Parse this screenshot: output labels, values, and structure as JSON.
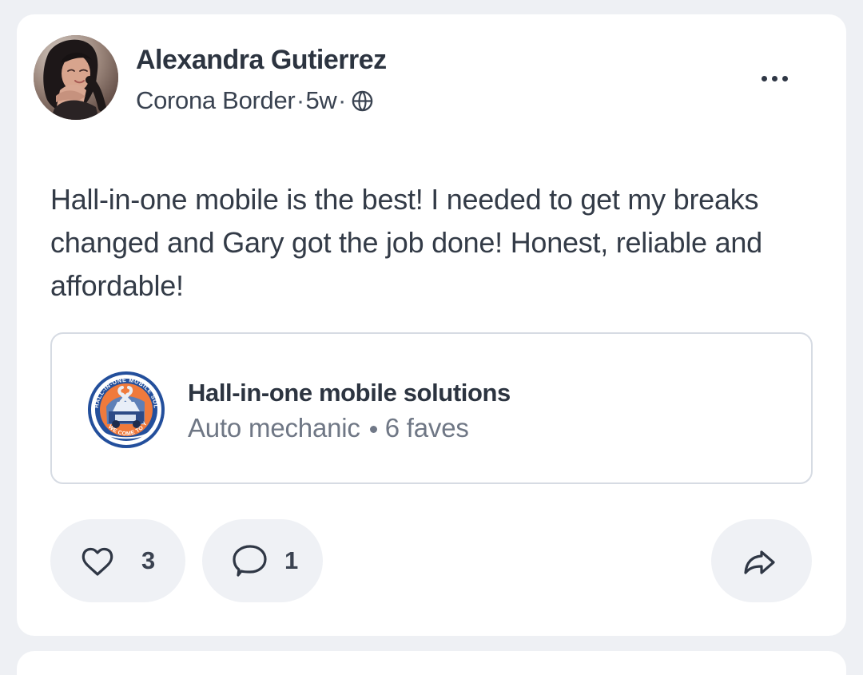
{
  "post": {
    "author": {
      "name": "Alexandra Gutierrez",
      "neighborhood": "Corona Border",
      "time_ago": "5w",
      "visibility_icon": "globe-icon"
    },
    "body": "Hall-in-one mobile is the best! I needed to get my breaks changed and Gary got the job done! Honest, reliable and affordable!",
    "more_icon": "more-dots-icon",
    "business": {
      "name": "Hall-in-one mobile solutions",
      "category": "Auto mechanic",
      "faves": "6 faves",
      "logo_text_top": "HALL-IN-ONE MOBILE SOLUTIONS",
      "logo_text_bottom": "WE COME TO YOU"
    },
    "actions": {
      "like_icon": "heart-icon",
      "like_count": "3",
      "comment_icon": "comment-icon",
      "comment_count": "1",
      "share_icon": "share-icon"
    }
  },
  "colors": {
    "page_background": "#eef0f4",
    "card_background": "#ffffff",
    "text_primary": "#2c3440",
    "text_secondary": "#6f7785",
    "pill_background": "#eff1f5",
    "border": "#d6dbe3",
    "logo_blue": "#234f9c",
    "logo_orange": "#f07a3c"
  }
}
